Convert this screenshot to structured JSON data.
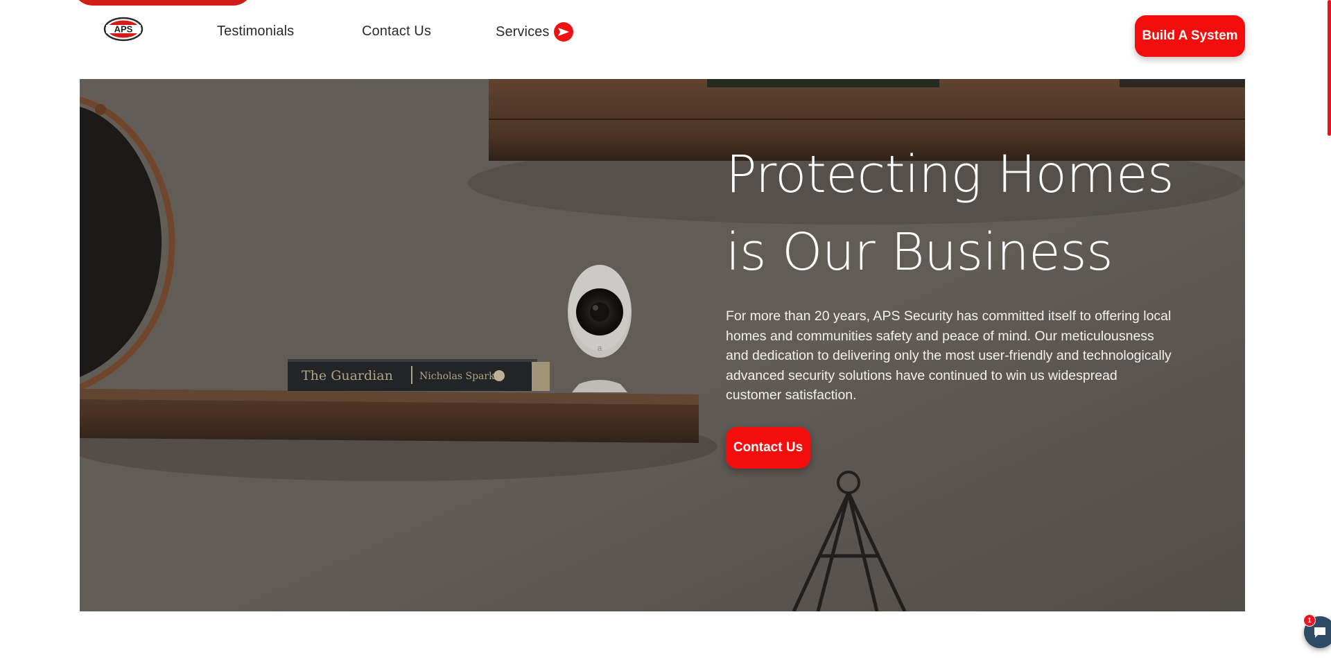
{
  "header": {
    "logo_text": "APS",
    "nav": {
      "testimonials": "Testimonials",
      "contact": "Contact Us",
      "services": "Services"
    },
    "cta_label": "Build A System"
  },
  "hero": {
    "title_line1": "Protecting Homes",
    "title_line2": "is Our Business",
    "description": "For more than 20 years, APS Security has committed itself to offering local homes and communities safety and peace of mind. Our meticulousness and dedication to delivering only the most user-friendly and technologically advanced security solutions have continued to win us widespread customer satisfaction.",
    "cta_label": "Contact Us",
    "book_spine_title": "The Guardian",
    "book_spine_author": "Nicholas Sparks"
  },
  "chat": {
    "badge_count": "1",
    "icon": "chat-bubble-icon"
  },
  "colors": {
    "accent": "#f50c0c",
    "chat": "#2f4a64",
    "hero_overlay": "#66605a"
  }
}
